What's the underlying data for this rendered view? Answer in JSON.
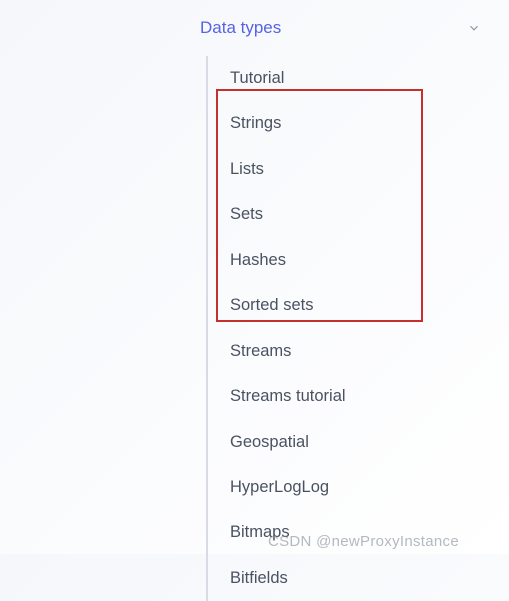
{
  "nav": {
    "title": "Data types",
    "items": [
      "Tutorial",
      "Strings",
      "Lists",
      "Sets",
      "Hashes",
      "Sorted sets",
      "Streams",
      "Streams tutorial",
      "Geospatial",
      "HyperLogLog",
      "Bitmaps",
      "Bitfields"
    ]
  },
  "highlighted_items": [
    "Strings",
    "Lists",
    "Sets",
    "Hashes",
    "Sorted sets"
  ],
  "watermark": "CSDN @newProxyInstance"
}
